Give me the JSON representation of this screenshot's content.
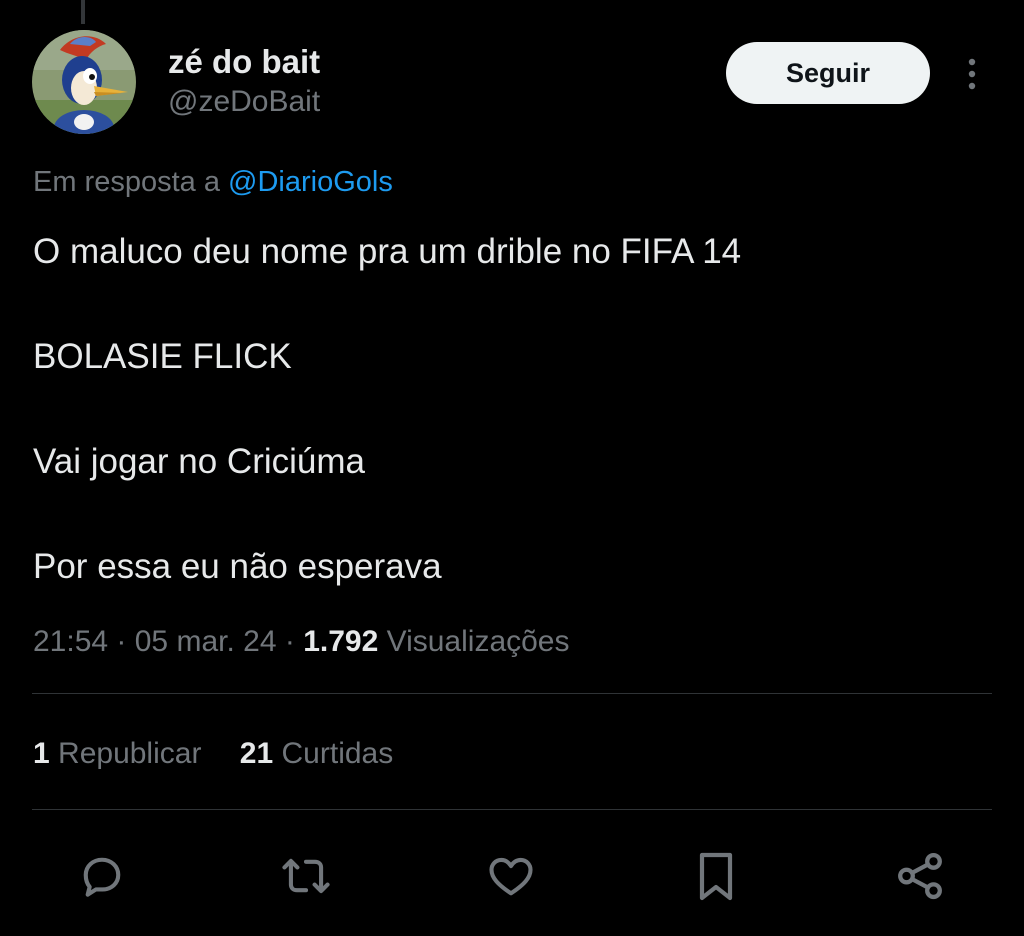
{
  "author": {
    "display_name": "zé do bait",
    "handle": "@zeDoBait",
    "avatar": "woodpecker-cartoon-avatar"
  },
  "follow_label": "Seguir",
  "reply_to": {
    "prefix": "Em resposta a",
    "mention": "@DiarioGols"
  },
  "tweet": {
    "paragraphs": [
      "O maluco deu nome pra um drible no FIFA 14",
      "BOLASIE FLICK",
      "Vai jogar no Criciúma",
      "Por essa eu não esperava"
    ]
  },
  "meta": {
    "time": "21:54",
    "date": "05 mar. 24",
    "views_count": "1.792",
    "views_label": "Visualizações"
  },
  "stats": {
    "reposts_count": "1",
    "reposts_label": "Republicar",
    "likes_count": "21",
    "likes_label": "Curtidas"
  },
  "actions": [
    "reply-icon",
    "repost-icon",
    "like-icon",
    "bookmark-icon",
    "share-icon"
  ],
  "colors": {
    "background": "#000000",
    "text": "#e7e9ea",
    "secondary": "#71767b",
    "link": "#1d9bf0",
    "divider": "#2f3336",
    "button_bg": "#eff3f4"
  }
}
